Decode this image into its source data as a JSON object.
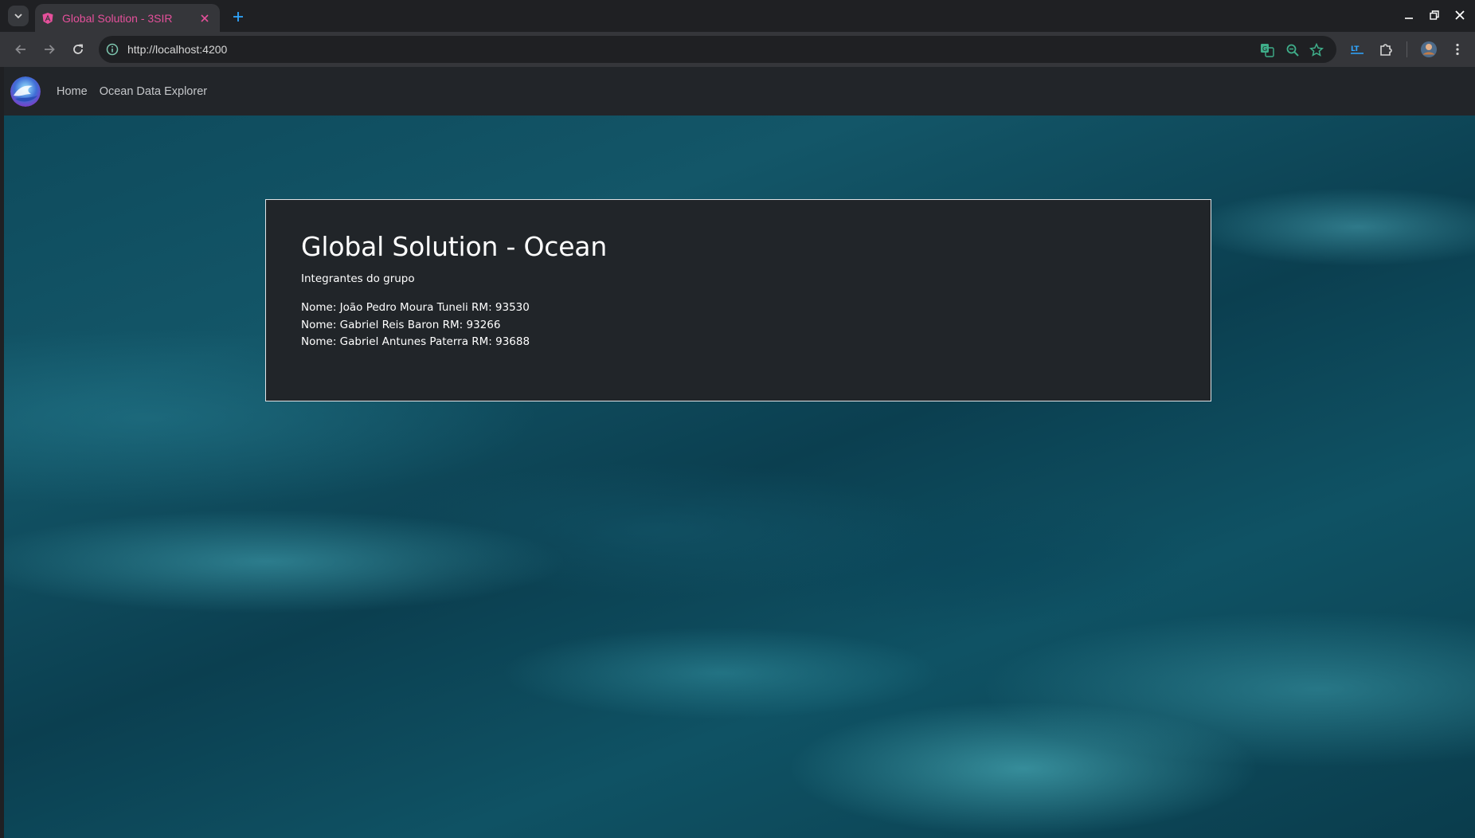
{
  "browser": {
    "tab_title": "Global Solution - 3SIR",
    "url": "http://localhost:4200",
    "accent_color": "#e5509b"
  },
  "app": {
    "nav": {
      "home_label": "Home",
      "explorer_label": "Ocean Data Explorer"
    }
  },
  "card": {
    "title": "Global Solution - Ocean",
    "subtitle": "Integrantes do grupo",
    "members": [
      "Nome: João Pedro Moura Tuneli RM: 93530",
      "Nome: Gabriel Reis Baron RM: 93266",
      "Nome: Gabriel Antunes Paterra RM: 93688"
    ]
  }
}
